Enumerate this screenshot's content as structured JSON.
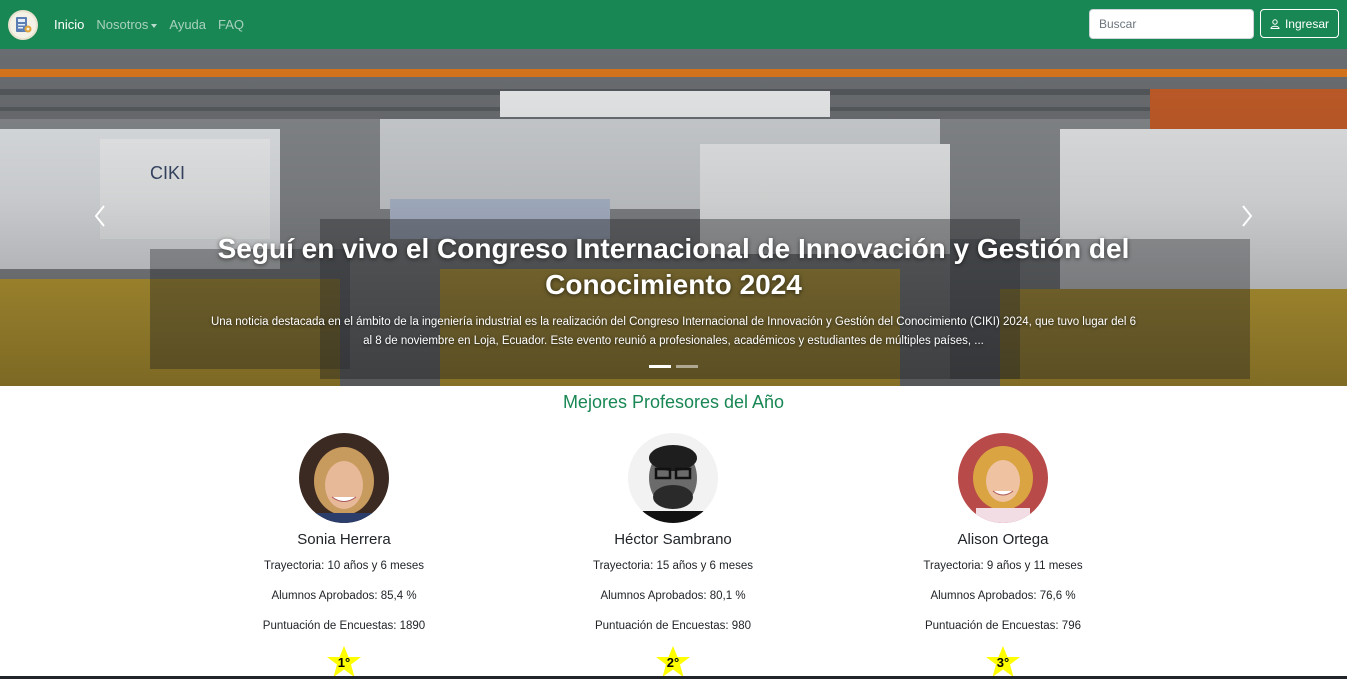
{
  "nav": {
    "links": [
      "Inicio",
      "Nosotros",
      "Ayuda",
      "FAQ"
    ],
    "search_placeholder": "Buscar",
    "login_label": "Ingresar",
    "brand_color": "#198754"
  },
  "carousel": {
    "title": "Seguí en vivo el Congreso Internacional de Innovación y Gestión del Conocimiento 2024",
    "text": "Una noticia destacada en el ámbito de la ingeniería industrial es la realización del Congreso Internacional de Innovación y Gestión del Conocimiento (CIKI) 2024, que tuvo lugar del 6 al 8 de noviembre en Loja, Ecuador. Este evento reunió a profesionales, académicos y estudiantes de múltiples países, ...",
    "slides": 2,
    "active_slide": 1
  },
  "teachers": {
    "title": "Mejores Profesores del Año",
    "list": [
      {
        "name": "Sonia Herrera",
        "trayectoria": "Trayectoria: 10 años y 6 meses",
        "aprobados": "Alumnos Aprobados: 85,4 %",
        "encuestas": "Puntuación de Encuestas: 1890",
        "rank": "1°"
      },
      {
        "name": "Héctor Sambrano",
        "trayectoria": "Trayectoria: 15 años y 6 meses",
        "aprobados": "Alumnos Aprobados: 80,1 %",
        "encuestas": "Puntuación de Encuestas: 980",
        "rank": "2°"
      },
      {
        "name": "Alison Ortega",
        "trayectoria": "Trayectoria: 9 años y 11 meses",
        "aprobados": "Alumnos Aprobados: 76,6 %",
        "encuestas": "Puntuación de Encuestas: 796",
        "rank": "3°"
      }
    ],
    "star_color": "#ffff00"
  }
}
